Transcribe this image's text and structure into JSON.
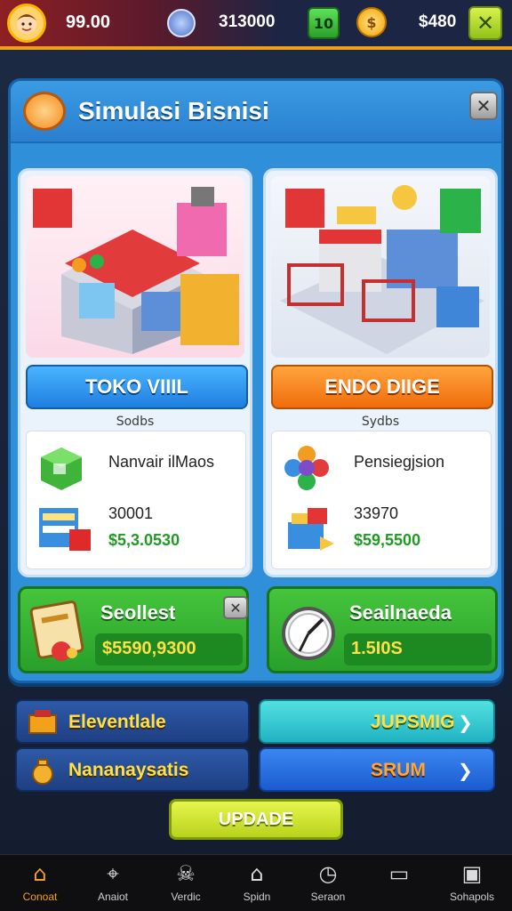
{
  "topbar": {
    "coins": "99.00",
    "gems": "313000",
    "level": "10",
    "cash": "$480",
    "close_label": "✕"
  },
  "panel": {
    "title": "Simulasi Bisnisi",
    "close_label": "✕"
  },
  "cards": [
    {
      "button_label": "TOKO VIIIL",
      "subtitle": "Sodbs",
      "info_label": "Nanvair ilMaos",
      "info_number": "30001",
      "info_money": "$5,3.0530"
    },
    {
      "button_label": "ENDO DIIGE",
      "subtitle": "Sydbs",
      "info_label": "Pensiegjsion",
      "info_number": "33970",
      "info_money": "$59,5500"
    }
  ],
  "stats": [
    {
      "title": "Seollest",
      "value": "$5590,9300",
      "close_label": "✕"
    },
    {
      "title": "Seailnaeda",
      "value": "1.5I0S"
    }
  ],
  "rows": [
    {
      "label": "Eleventlale",
      "action_label": "JUPSMIG",
      "action_arrow": "❯"
    },
    {
      "label": "Nananaysatis",
      "action_label": "SRUM",
      "action_arrow": "❯"
    }
  ],
  "update_label": "UPDADE",
  "bottomnav": [
    {
      "label": "Conoat",
      "icon": "home-icon",
      "glyph": "⌂"
    },
    {
      "label": "Anaiot",
      "icon": "tag-icon",
      "glyph": "⌖"
    },
    {
      "label": "Verdic",
      "icon": "wolf-icon",
      "glyph": "☠"
    },
    {
      "label": "Spidn",
      "icon": "house-icon",
      "glyph": "⌂"
    },
    {
      "label": "Seraon",
      "icon": "clock-icon",
      "glyph": "◷"
    },
    {
      "label": "",
      "icon": "window-icon",
      "glyph": "▭"
    },
    {
      "label": "Sohapols",
      "icon": "document-icon",
      "glyph": "▣"
    }
  ],
  "colors": {
    "accent": "#f2a21a",
    "panel_blue": "#2f8fd8",
    "green": "#28a02a",
    "money_green": "#1f9a23"
  }
}
